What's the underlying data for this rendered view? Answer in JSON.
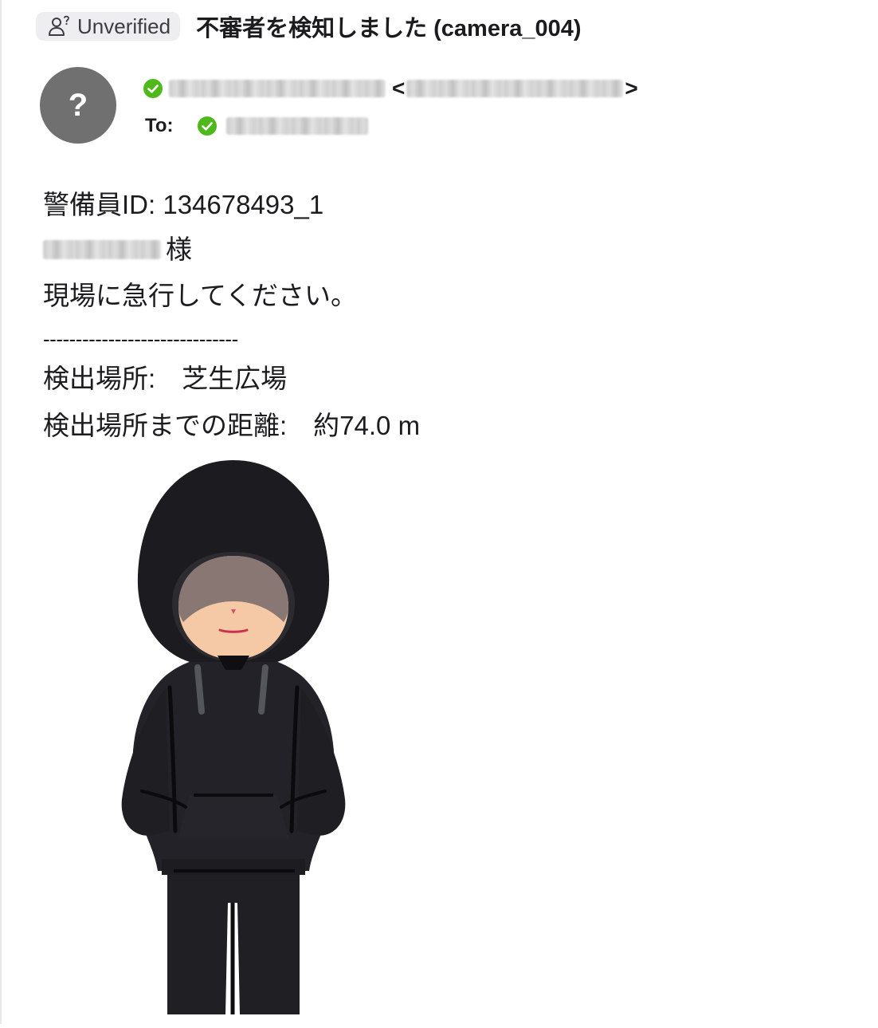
{
  "header": {
    "badge_label": "Unverified",
    "subject": "不審者を検知しました (camera_004)"
  },
  "sender": {
    "avatar_glyph": "?",
    "open_angle": "<",
    "close_angle": ">"
  },
  "recipient": {
    "to_label": "To:"
  },
  "message": {
    "guard_id_line": "警備員ID: 134678493_1",
    "honorific": "様",
    "instruction": "現場に急行してください。",
    "separator": "------------------------------",
    "location_line": "検出場所:　芝生広場",
    "distance_line": "検出場所までの距離:　約74.0 m"
  },
  "icons": {
    "badge_icon": "person-question-icon",
    "verified_icon": "green-check-circle-icon",
    "illustration": "hooded-person-illustration"
  },
  "colors": {
    "verified_green": "#4fb81a",
    "avatar_gray": "#707070",
    "badge_bg": "#eeeef0"
  }
}
